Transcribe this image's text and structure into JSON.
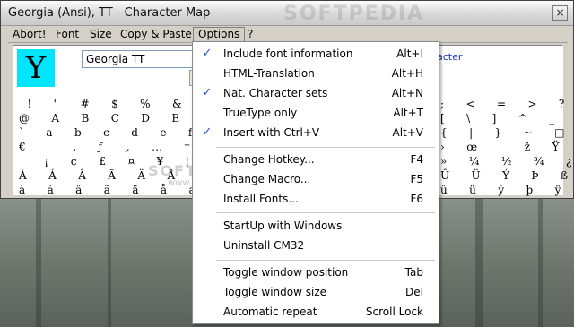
{
  "window": {
    "title": "Georgia (Ansi), TT  - Character Map",
    "watermark": "SOFTPEDIA",
    "close_glyph": "×"
  },
  "menubar": {
    "items": [
      "Abort!",
      "Font",
      "Size",
      "Copy & Paste",
      "Options",
      "?"
    ]
  },
  "content": {
    "preview_char": "Y",
    "font_select_value": "Georgia TT",
    "right_link_text": "acter",
    "watermark": "SOFTPEDIA",
    "watermark_sub": "www.softpedia.com",
    "grid_left": [
      " !  \"  #  $  %  &  '  (  )  *",
      "@  A  B  C  D  E  F  G  H  I  J",
      "`  a  b  c  d  e  f  g  h  i  j",
      "€     ‚  ƒ  „  …  †  ‡  ˆ  ‰  Š",
      "   ¡  ¢  £  ¤  ¥  ¦  §  ¨  ©  ª",
      "À  Á  Â  Ã  Ä  Å  Æ  Ç  È  É  Ê",
      "à  á  â  ã  ä  å  æ  ç  è  é  ê"
    ],
    "grid_right": [
      ";  <  =  >  ?",
      "[  \\  ]  ^  _",
      "{  |  }  ~  □",
      "›  œ     ž  Ÿ",
      "»  ¼  ½  ¾  ¿",
      "Û  Ü  Ý  Þ  ß",
      "û  ü  ý  þ  ÿ"
    ]
  },
  "options_menu": {
    "groups": [
      [
        {
          "label": "Include font information",
          "shortcut": "Alt+I",
          "checked": true
        },
        {
          "label": "HTML-Translation",
          "shortcut": "Alt+H",
          "checked": false
        },
        {
          "label": "Nat. Character sets",
          "shortcut": "Alt+N",
          "checked": true
        },
        {
          "label": "TrueType only",
          "shortcut": "Alt+T",
          "checked": false
        },
        {
          "label": "Insert with Ctrl+V",
          "shortcut": "Alt+V",
          "checked": true
        }
      ],
      [
        {
          "label": "Change Hotkey...",
          "shortcut": "F4",
          "checked": false
        },
        {
          "label": "Change Macro...",
          "shortcut": "F5",
          "checked": false
        },
        {
          "label": "Install Fonts...",
          "shortcut": "F6",
          "checked": false
        }
      ],
      [
        {
          "label": "StartUp with Windows",
          "shortcut": "",
          "checked": false
        },
        {
          "label": "Uninstall CM32",
          "shortcut": "",
          "checked": false
        }
      ],
      [
        {
          "label": "Toggle window position",
          "shortcut": "Tab",
          "checked": false
        },
        {
          "label": "Toggle window size",
          "shortcut": "Del",
          "checked": false
        },
        {
          "label": "Automatic repeat",
          "shortcut": "Scroll Lock",
          "checked": false
        }
      ]
    ],
    "check_glyph": "✓"
  }
}
